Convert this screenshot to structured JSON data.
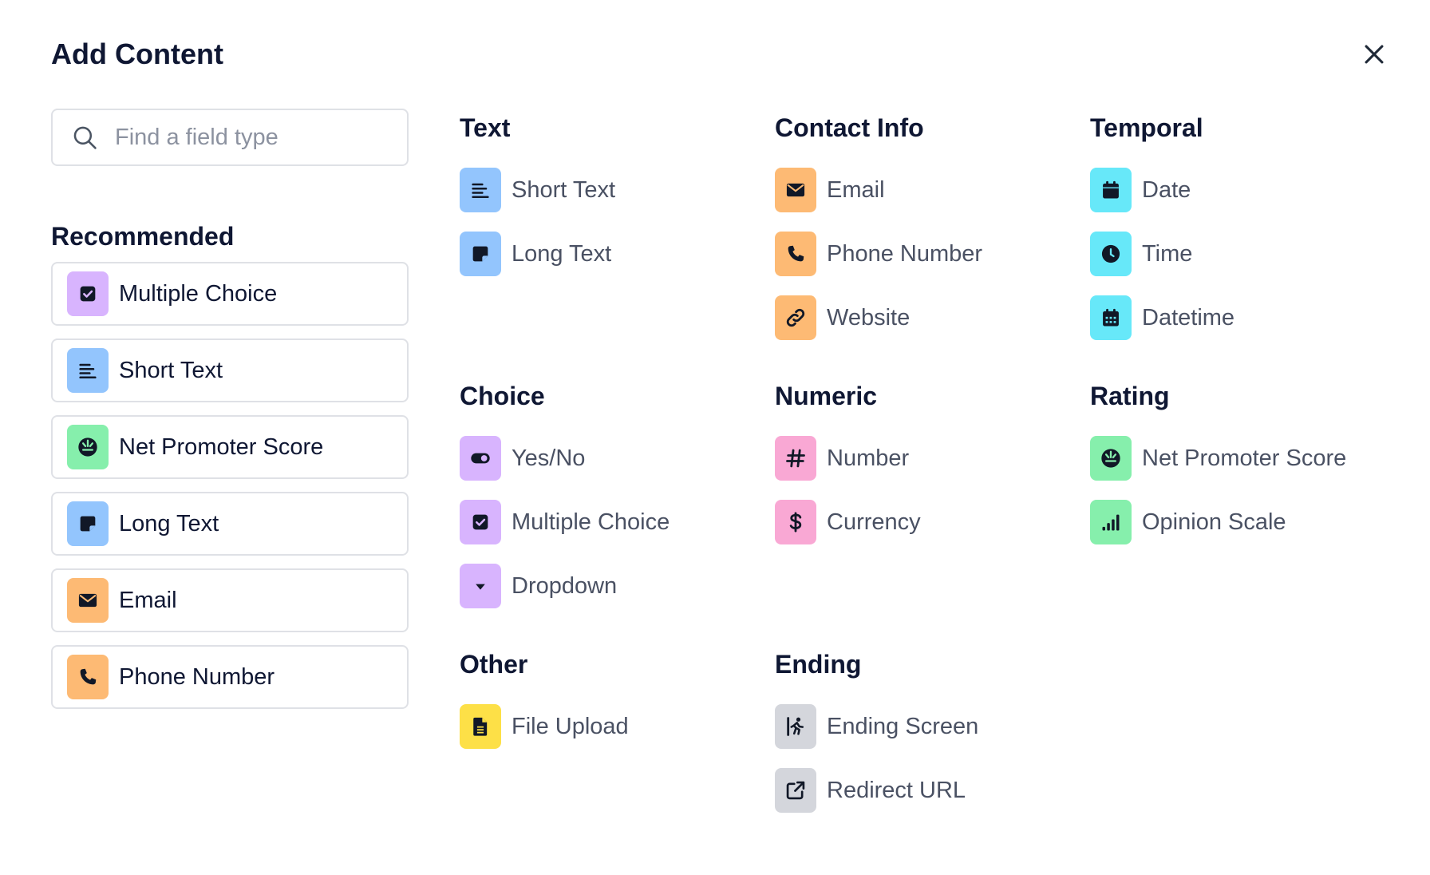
{
  "title": "Add Content",
  "search": {
    "placeholder": "Find a field type"
  },
  "recommended": {
    "heading": "Recommended",
    "items": [
      {
        "label": "Multiple Choice",
        "icon": "checkbox-icon",
        "color": "#d8b4fe"
      },
      {
        "label": "Short Text",
        "icon": "short-text-icon",
        "color": "#93c5fd"
      },
      {
        "label": "Net Promoter Score",
        "icon": "gauge-icon",
        "color": "#86efac"
      },
      {
        "label": "Long Text",
        "icon": "note-icon",
        "color": "#93c5fd"
      },
      {
        "label": "Email",
        "icon": "envelope-icon",
        "color": "#fdba74"
      },
      {
        "label": "Phone Number",
        "icon": "phone-icon",
        "color": "#fdba74"
      }
    ]
  },
  "groups": {
    "text": {
      "title": "Text",
      "items": [
        {
          "label": "Short Text",
          "icon": "short-text-icon"
        },
        {
          "label": "Long Text",
          "icon": "note-icon"
        }
      ]
    },
    "contact": {
      "title": "Contact Info",
      "items": [
        {
          "label": "Email",
          "icon": "envelope-icon"
        },
        {
          "label": "Phone Number",
          "icon": "phone-icon"
        },
        {
          "label": "Website",
          "icon": "link-icon"
        }
      ]
    },
    "temporal": {
      "title": "Temporal",
      "items": [
        {
          "label": "Date",
          "icon": "calendar-icon"
        },
        {
          "label": "Time",
          "icon": "clock-icon"
        },
        {
          "label": "Datetime",
          "icon": "calendar-grid-icon"
        }
      ]
    },
    "choice": {
      "title": "Choice",
      "items": [
        {
          "label": "Yes/No",
          "icon": "toggle-icon"
        },
        {
          "label": "Multiple Choice",
          "icon": "checkbox-icon"
        },
        {
          "label": "Dropdown",
          "icon": "caret-down-icon"
        }
      ]
    },
    "numeric": {
      "title": "Numeric",
      "items": [
        {
          "label": "Number",
          "icon": "hash-icon"
        },
        {
          "label": "Currency",
          "icon": "dollar-icon"
        }
      ]
    },
    "rating": {
      "title": "Rating",
      "items": [
        {
          "label": "Net Promoter Score",
          "icon": "gauge-icon"
        },
        {
          "label": "Opinion Scale",
          "icon": "bars-icon"
        }
      ]
    },
    "other": {
      "title": "Other",
      "items": [
        {
          "label": "File Upload",
          "icon": "file-icon"
        }
      ]
    },
    "ending": {
      "title": "Ending",
      "items": [
        {
          "label": "Ending Screen",
          "icon": "runner-exit-icon"
        },
        {
          "label": "Redirect URL",
          "icon": "external-link-icon"
        }
      ]
    }
  },
  "colors": {
    "text": "#93c5fd",
    "contact": "#fdba74",
    "temporal": "#67e8f9",
    "choice": "#d8b4fe",
    "numeric": "#f9a8d4",
    "rating": "#86efac",
    "other": "#fde047",
    "ending": "#d4d6dc"
  }
}
